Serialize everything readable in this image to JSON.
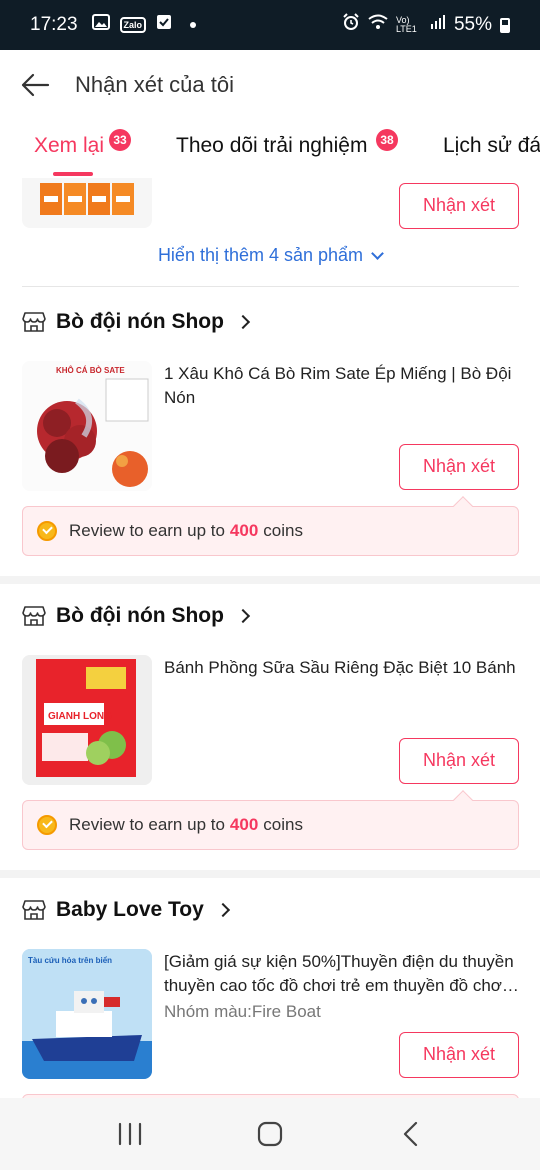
{
  "status_bar": {
    "time": "17:23",
    "battery": "55%",
    "network": "Vo) LTE1",
    "icons": [
      "gallery-icon",
      "zalo-icon",
      "check-icon",
      "dot-icon",
      "alarm-icon",
      "wifi-icon",
      "signal-icon",
      "battery-icon"
    ],
    "zalo_label": "Zalo"
  },
  "header": {
    "title": "Nhận xét của tôi",
    "back_icon": "arrow-left-icon"
  },
  "tabs": [
    {
      "label": "Xem lại",
      "badge": "33",
      "active": true
    },
    {
      "label": "Theo dõi trải nghiệm",
      "badge": "38",
      "active": false
    },
    {
      "label": "Lịch sử đá",
      "active": false
    }
  ],
  "review_button_label": "Nhận xét",
  "show_more": {
    "label": "Hiển thị thêm 4 sản phẩm"
  },
  "coin_prompt": {
    "prefix": "Review to earn up to",
    "amount": "400",
    "suffix": "coins"
  },
  "orders": [
    {
      "shop_name": "Bò đội nón Shop",
      "product_title": "1 Xâu Khô Cá Bò Rim Sate Ép Miếng | Bò Đội Nón",
      "thumb_label": "KHÔ CÁ BÒ SATE"
    },
    {
      "shop_name": "Bò đội nón Shop",
      "product_title": "Bánh Phồng Sữa Sầu Riêng Đặc Biệt 10 Bánh",
      "thumb_label": "GIANH LONG"
    },
    {
      "shop_name": "Baby Love Toy",
      "product_title": "[Giảm giá sự kiện 50%]Thuyền điện du thuyền thuyền cao tốc đồ chơi trẻ em thuyền đồ chơ…",
      "variant": "Nhóm màu:Fire Boat",
      "thumb_label": "Tàu cứu hỏa trên biển"
    }
  ],
  "colors": {
    "accent": "#f5385f",
    "link": "#2f6fd9",
    "status_bar": "#0f1c26",
    "coin_bg": "#fff1f2"
  },
  "nav_bar": {
    "icons": [
      "recent-apps-icon",
      "home-icon",
      "back-icon"
    ]
  }
}
